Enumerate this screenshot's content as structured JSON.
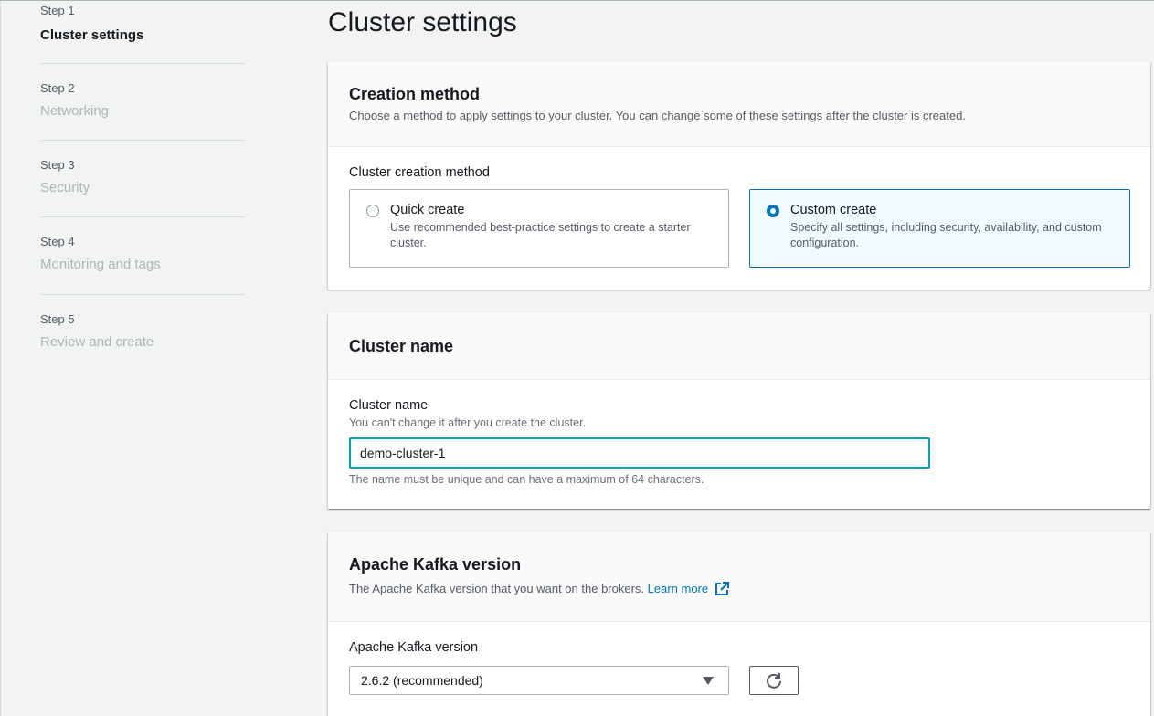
{
  "steps": [
    {
      "label": "Step 1",
      "title": "Cluster settings",
      "active": true
    },
    {
      "label": "Step 2",
      "title": "Networking",
      "active": false
    },
    {
      "label": "Step 3",
      "title": "Security",
      "active": false
    },
    {
      "label": "Step 4",
      "title": "Monitoring and tags",
      "active": false
    },
    {
      "label": "Step 5",
      "title": "Review and create",
      "active": false
    }
  ],
  "page": {
    "title": "Cluster settings"
  },
  "creation_method": {
    "title": "Creation method",
    "description": "Choose a method to apply settings to your cluster. You can change some of these settings after the cluster is created.",
    "field_label": "Cluster creation method",
    "options": [
      {
        "title": "Quick create",
        "description": "Use recommended best-practice settings to create a starter cluster.",
        "selected": false
      },
      {
        "title": "Custom create",
        "description": "Specify all settings, including security, availability, and custom configuration.",
        "selected": true
      }
    ]
  },
  "cluster_name": {
    "title": "Cluster name",
    "field_label": "Cluster name",
    "field_description": "You can't change it after you create the cluster.",
    "value": "demo-cluster-1",
    "constraint": "The name must be unique and can have a maximum of 64 characters."
  },
  "kafka_version": {
    "title": "Apache Kafka version",
    "description": "The Apache Kafka version that you want on the brokers.",
    "learn_more": "Learn more",
    "field_label": "Apache Kafka version",
    "selected": "2.6.2 (recommended)"
  },
  "colors": {
    "accent": "#0073bb",
    "focus": "#00a1c9",
    "background": "#f2f3f3",
    "disabled_text": "#aab7b8"
  },
  "icons": {
    "external_link": "external-link-icon",
    "refresh": "refresh-icon",
    "dropdown": "caret-down-icon"
  }
}
